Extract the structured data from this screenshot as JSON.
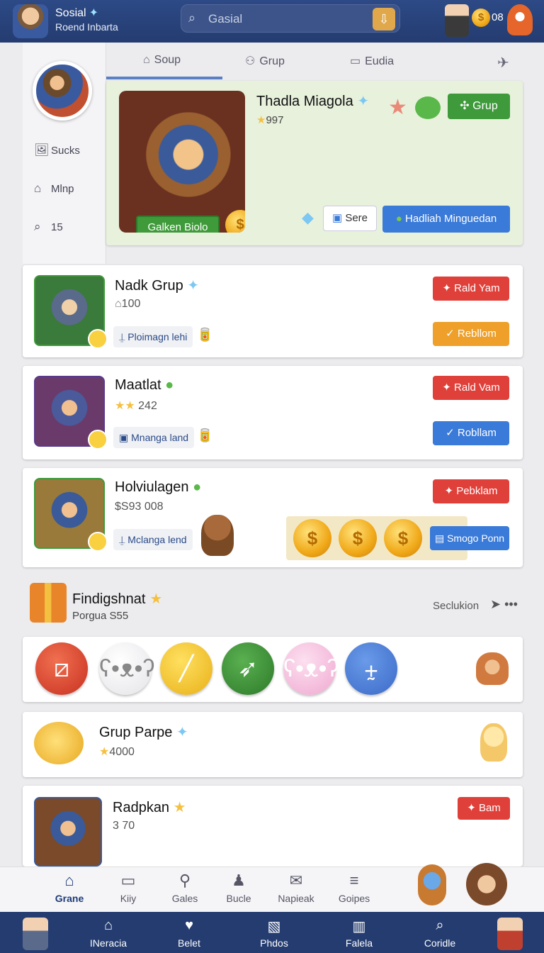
{
  "topbar": {
    "title": "Sosial",
    "subtitle": "Roend Inbarta",
    "search_placeholder": "Gasial",
    "coins": "08"
  },
  "sidebar": {
    "items": [
      {
        "label": "Sucks",
        "icon": "image-icon"
      },
      {
        "label": "Mlnp",
        "icon": "home-icon"
      },
      {
        "label": "15",
        "icon": "search-icon"
      }
    ]
  },
  "tabs": [
    {
      "label": "Soup",
      "icon": "home-icon"
    },
    {
      "label": "Grup",
      "icon": "users-icon"
    },
    {
      "label": "Eudia",
      "icon": "doc-icon"
    }
  ],
  "featured": {
    "title": "Thadla Miagola",
    "rating": "997",
    "green_button": "Galken Biolo",
    "grup_button": "Grup",
    "sere_button": "Sere",
    "hadiah_button": "Hadliah Minguedan"
  },
  "cards": [
    {
      "title": "Nadk Grup",
      "sub": "100",
      "chip": "Ploimagn lehi",
      "btn1": "Rald Yam",
      "btn2": "Rebllom"
    },
    {
      "title": "Maatlat",
      "sub": "242",
      "chip": "Mnanga land",
      "btn1": "Rald Vam",
      "btn2": "Robllam"
    },
    {
      "title": "Holviulagen",
      "sub": "$S93 008",
      "chip": "Mclanga lend",
      "btn1": "Pebklam",
      "btn2": "Smogo Ponn"
    }
  ],
  "section": {
    "title": "Findigshnat",
    "sub": "Porgua S55",
    "right": "Seclukion"
  },
  "list_items": [
    {
      "title": "Grup Parpe",
      "sub": "4000"
    },
    {
      "title": "Radpkan",
      "sub": "3 70",
      "btn": "Bam"
    }
  ],
  "bottom_tabs": [
    {
      "label": "Grane",
      "icon": "home-icon",
      "active": true
    },
    {
      "label": "Kiiy",
      "icon": "chat-icon"
    },
    {
      "label": "Gales",
      "icon": "users-icon"
    },
    {
      "label": "Bucle",
      "icon": "user-icon"
    },
    {
      "label": "Napieak",
      "icon": "mail-icon"
    },
    {
      "label": "Goipes",
      "icon": "menu-icon"
    }
  ],
  "navbar": [
    {
      "label": "INeracia",
      "icon": "home-icon"
    },
    {
      "label": "Belet",
      "icon": "heart-icon"
    },
    {
      "label": "Phdos",
      "icon": "photo-icon"
    },
    {
      "label": "Falela",
      "icon": "book-icon"
    },
    {
      "label": "Coridle",
      "icon": "search-icon"
    }
  ],
  "colors": {
    "header": "#243c70",
    "green": "#3e9a3a",
    "red": "#e0403a",
    "orange": "#eea02a",
    "blue": "#3a7ad8"
  }
}
